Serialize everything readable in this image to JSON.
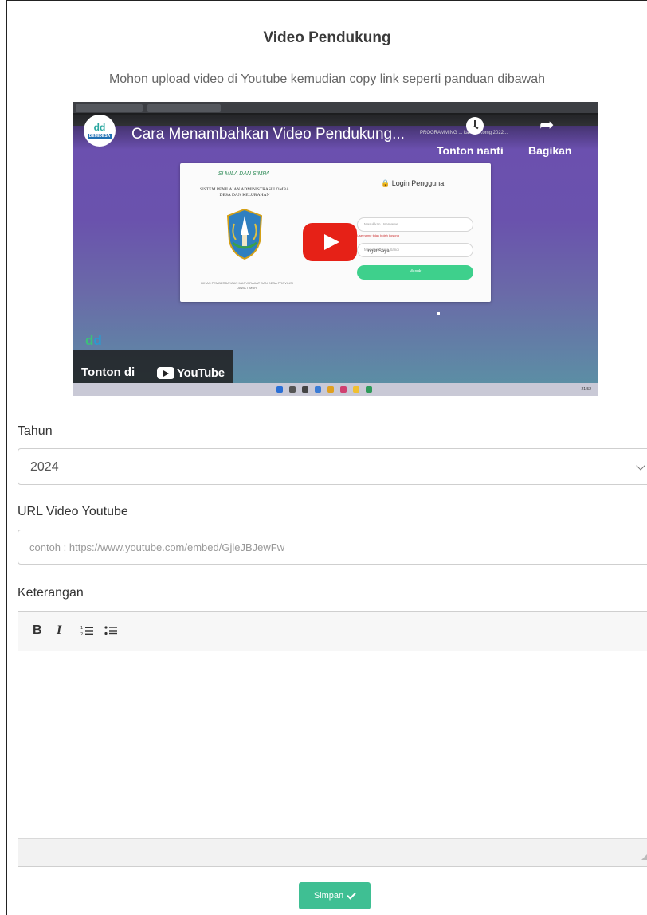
{
  "section": {
    "title": "Video Pendukung",
    "subtitle": "Mohon upload video di Youtube kemudian copy link seperti panduan dibawah"
  },
  "video": {
    "title": "Cara Menambahkan Video Pendukung...",
    "watch_later_label": "Tonton nanti",
    "share_label": "Bagikan",
    "watch_on_label": "Tonton di",
    "youtube_wordmark": "YouTube",
    "channel_logo_text": "DEMIDESA",
    "screen": {
      "brand": "SI MILA DAN SIMPA",
      "system_name": "SISTEM PENILAIAN ADMINISTRASI LOMBA DESA DAN KELURAHAN",
      "login_title": "Login Pengguna",
      "username_placeholder": "Masukkan Username",
      "username_error": "Username tidak boleh kosong",
      "password_placeholder": "Masukkan Kata Sandi",
      "remember_label": "Ingat Saya",
      "login_button": "Masuk",
      "footer": "DINAS PEMBERDAYAAN MASYARAKAT DAN DESA PROVINSI JAWA TIMUR",
      "tab_tail": "PROGRAMMING ... kamus Komg 2022..."
    },
    "clock_text": "21:52"
  },
  "form": {
    "year_label": "Tahun",
    "year_value": "2024",
    "url_label": "URL Video Youtube",
    "url_placeholder": "contoh : https://www.youtube.com/embed/GjleJBJewFw",
    "notes_label": "Keterangan",
    "toolbar": {
      "bold": "B",
      "italic": "I"
    },
    "save_label": "Simpan"
  },
  "colors": {
    "save_button": "#3fbf93",
    "play_button": "#e62117",
    "video_bg_top": "#6c4fb0",
    "video_bg_bottom": "#5a93a4"
  }
}
